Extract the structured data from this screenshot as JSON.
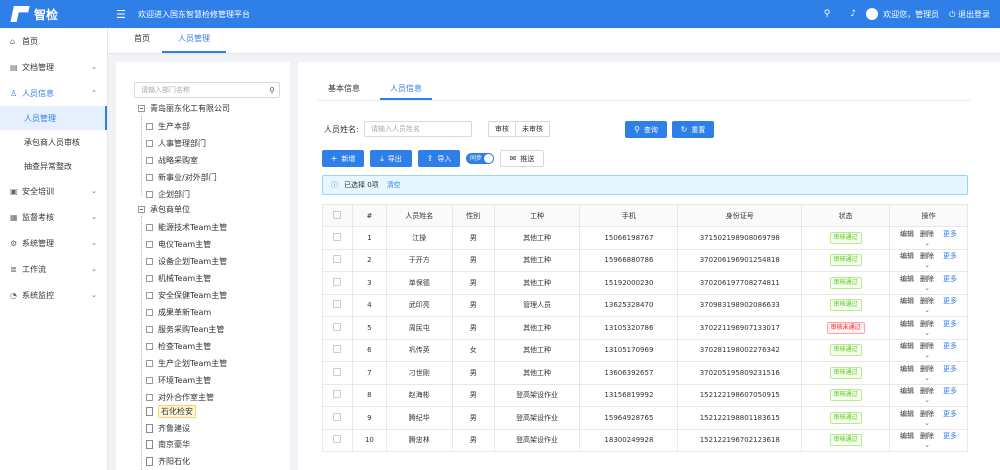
{
  "header": {
    "logo_text": "智检",
    "welcome": "欢迎进入国东智慧检修管理平台",
    "user_greeting": "欢迎您，管理员",
    "logout": "退出登录"
  },
  "sidebar": {
    "items": [
      {
        "label": "首页",
        "icon": "home-icon",
        "expanded": false
      },
      {
        "label": "文档管理",
        "icon": "document-icon",
        "expanded": false
      },
      {
        "label": "人员信息",
        "icon": "user-icon",
        "expanded": true,
        "children": [
          {
            "label": "人员管理",
            "active": true
          },
          {
            "label": "承包商人员审核",
            "active": false
          },
          {
            "label": "抽查异常整改",
            "active": false
          }
        ]
      },
      {
        "label": "安全培训",
        "icon": "training-icon",
        "expanded": false
      },
      {
        "label": "监督考核",
        "icon": "supervision-icon",
        "expanded": false
      },
      {
        "label": "系统管理",
        "icon": "settings-icon",
        "expanded": false
      },
      {
        "label": "工作流",
        "icon": "workflow-icon",
        "expanded": false
      },
      {
        "label": "系统监控",
        "icon": "monitor-icon",
        "expanded": false
      }
    ]
  },
  "page_tabs": [
    "首页",
    "人员管理"
  ],
  "tree": {
    "search_placeholder": "请输入部门名称",
    "root1": "青岛丽东化工有限公司",
    "group1": [
      "生产本部",
      "人事管理部门",
      "战略采购室",
      "新事业/对外部门",
      "企划部门"
    ],
    "root2": "承包商单位",
    "group2": [
      "能源技术Team主管",
      "电仪Team主管",
      "设备企划Team主管",
      "机械Team主管",
      "安全保健Team主管",
      "成果革新Team",
      "服务采购Tean主管",
      "检查Team主管",
      "生产企划Team主管",
      "环境Team主管",
      "对外合作室主管"
    ],
    "files": [
      "石化检安",
      "齐鲁建设",
      "南京豪华",
      "齐阳石化"
    ],
    "selected": "石化检安"
  },
  "inner_tabs": [
    "基本信息",
    "人员信息"
  ],
  "filter": {
    "name_label": "人员姓名:",
    "name_placeholder": "请输入人员姓名",
    "seg": [
      "审核",
      "未审核"
    ],
    "query": "查询",
    "reset": "重置"
  },
  "toolbar": {
    "add": "新增",
    "export": "导出",
    "import": "导入",
    "toggle": "同步",
    "push": "推送"
  },
  "selection": {
    "text": "已选择 0项",
    "clear": "清空"
  },
  "table": {
    "headers": [
      "",
      "#",
      "人员姓名",
      "性别",
      "工种",
      "手机",
      "身份证号",
      "状态",
      "操作"
    ],
    "ops": {
      "edit": "编辑",
      "delete": "删除",
      "more": "更多"
    },
    "rows": [
      {
        "no": "1",
        "name": "江操",
        "gender": "男",
        "job": "其他工种",
        "phone": "15066198767",
        "id": "371502198908069798",
        "status": "审核通过",
        "ok": true
      },
      {
        "no": "2",
        "name": "于开方",
        "gender": "男",
        "job": "其他工种",
        "phone": "15966880786",
        "id": "370206196901254818",
        "status": "审核通过",
        "ok": true
      },
      {
        "no": "3",
        "name": "单保德",
        "gender": "男",
        "job": "其他工种",
        "phone": "15192000230",
        "id": "370206197708274811",
        "status": "审核通过",
        "ok": true
      },
      {
        "no": "4",
        "name": "武印亮",
        "gender": "男",
        "job": "管理人员",
        "phone": "13625328470",
        "id": "370983198902086633",
        "status": "审核通过",
        "ok": true
      },
      {
        "no": "5",
        "name": "周民屯",
        "gender": "男",
        "job": "其他工种",
        "phone": "13105320786",
        "id": "370221196907133017",
        "status": "审核未通过",
        "ok": false
      },
      {
        "no": "6",
        "name": "巩传英",
        "gender": "女",
        "job": "其他工种",
        "phone": "13105170969",
        "id": "370281198002276342",
        "status": "审核通过",
        "ok": true
      },
      {
        "no": "7",
        "name": "刁世刚",
        "gender": "男",
        "job": "其他工种",
        "phone": "13606392657",
        "id": "370205195809231516",
        "status": "审核通过",
        "ok": true
      },
      {
        "no": "8",
        "name": "赵海彬",
        "gender": "男",
        "job": "登高架设作业",
        "phone": "13156819992",
        "id": "152122198607050915",
        "status": "审核通过",
        "ok": true
      },
      {
        "no": "9",
        "name": "腾纪华",
        "gender": "男",
        "job": "登高架设作业",
        "phone": "15964928765",
        "id": "152122198801183615",
        "status": "审核通过",
        "ok": true
      },
      {
        "no": "10",
        "name": "腾忠林",
        "gender": "男",
        "job": "登高架设作业",
        "phone": "18300249928",
        "id": "152122196702123618",
        "status": "审核通过",
        "ok": true
      }
    ]
  }
}
